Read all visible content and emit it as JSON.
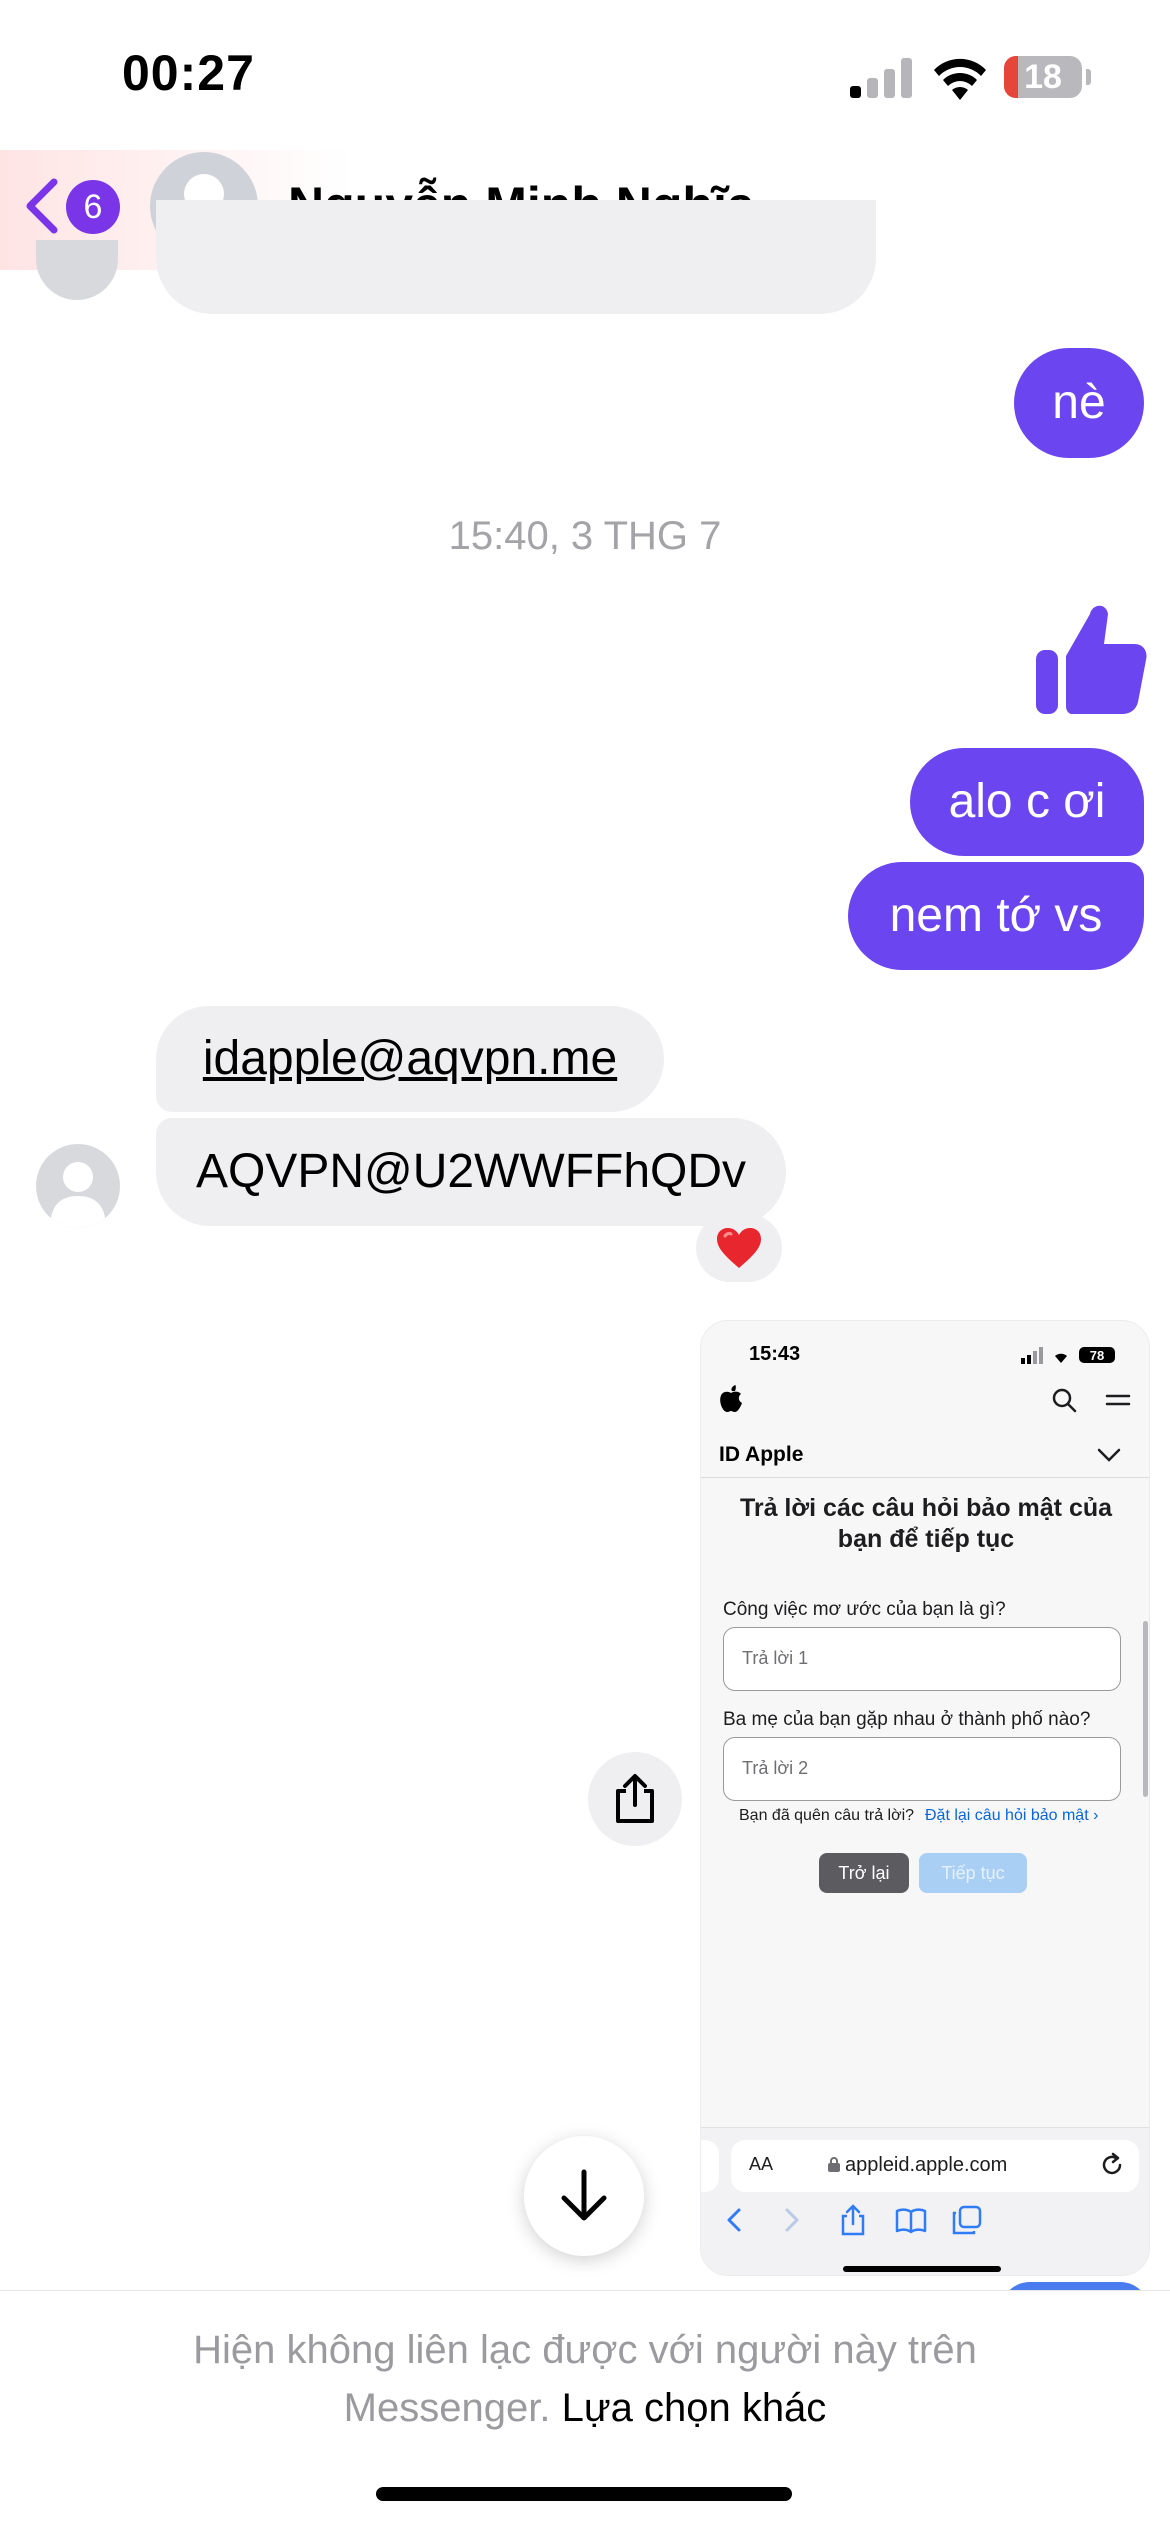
{
  "status_bar": {
    "time": "00:27",
    "battery_level": "18",
    "battery_fraction": 0.18,
    "battery_color": "#e6463a"
  },
  "header": {
    "back_badge": "6",
    "contact_name": "Nguyễn Minh Nghĩa",
    "accent_color": "#7b35e8"
  },
  "messages": {
    "out_ne": "nè",
    "timestamp": "15:40, 3 THG 7",
    "thumbs_up_icon": "thumbs-up-icon",
    "out_alo": "alo c ơi",
    "out_nem": "nem tớ vs",
    "in_email": "idapple@aqvpn.me",
    "in_password": "AQVPN@U2WWFFhQDv",
    "reaction_icon": "heart-icon",
    "outgoing_color": "#6b45f0",
    "incoming_color": "#efeff1"
  },
  "attachment": {
    "time": "15:43",
    "battery": "78",
    "section_title": "ID Apple",
    "heading": "Trả lời các câu hỏi bảo mật của bạn để tiếp tục",
    "question_1": "Công việc mơ ước của bạn là gì?",
    "answer_1_placeholder": "Trả lời 1",
    "question_2": "Ba mẹ của bạn gặp nhau ở thành phố nào?",
    "answer_2_placeholder": "Trả lời 2",
    "forgot_text": "Bạn đã quên câu trả lời?",
    "reset_link": "Đặt lại câu hỏi bảo mật ›",
    "back_button": "Trở lại",
    "continue_button": "Tiếp tục",
    "aa_label": "AA",
    "url": "appleid.apple.com"
  },
  "footer": {
    "message": "Hiện không liên lạc được với người này trên Messenger.",
    "link": "Lựa chọn khác"
  }
}
